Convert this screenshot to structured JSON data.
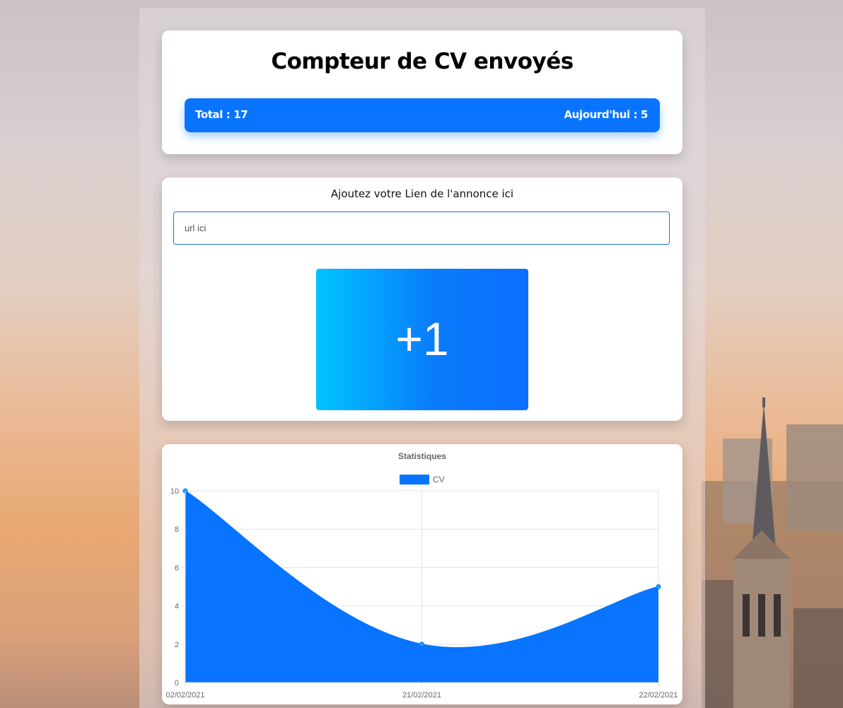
{
  "header": {
    "title": "Compteur de CV envoyés",
    "total_text": "Total : 17",
    "today_text": "Aujourd'hui : 5"
  },
  "form": {
    "label": "Ajoutez votre Lien de l'annonce ici",
    "url_placeholder": "url ici",
    "url_value": "",
    "add_button_label": "+1"
  },
  "colors": {
    "accent": "#0874ff",
    "button_gradient_start": "#01c4ff",
    "button_gradient_end": "#0c6efc"
  },
  "chart_data": {
    "type": "area",
    "title": "Statistiques",
    "x": [
      "02/02/2021",
      "21/02/2021",
      "22/02/2021"
    ],
    "series": [
      {
        "name": "CV",
        "values": [
          10,
          2,
          5
        ],
        "color": "#0874ff"
      }
    ],
    "ylim": [
      0,
      10
    ],
    "yticks": [
      0,
      2,
      4,
      6,
      8,
      10
    ],
    "grid": true,
    "legend": "top-center"
  }
}
